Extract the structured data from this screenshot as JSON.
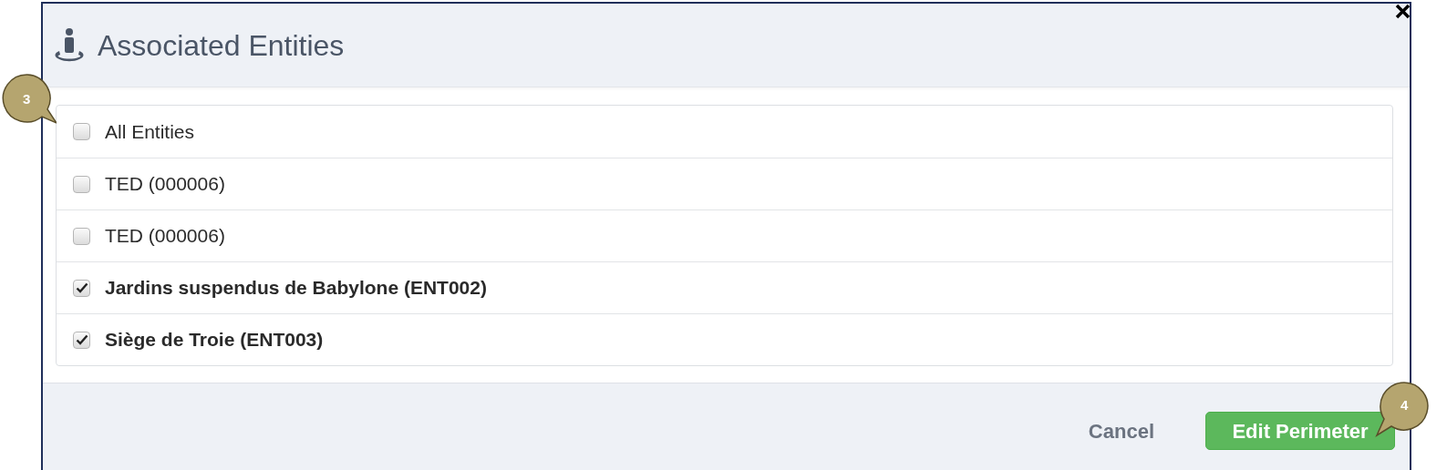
{
  "dialog": {
    "title": "Associated Entities"
  },
  "entities": [
    {
      "label": "All Entities",
      "checked": false
    },
    {
      "label": "TED (000006)",
      "checked": false
    },
    {
      "label": "TED (000006)",
      "checked": false
    },
    {
      "label": "Jardins suspendus de Babylone (ENT002)",
      "checked": true
    },
    {
      "label": "Siège de Troie (ENT003)",
      "checked": true
    }
  ],
  "buttons": {
    "cancel": "Cancel",
    "confirm": "Edit Perimeter"
  },
  "callouts": [
    {
      "label": "3",
      "kind": "left"
    },
    {
      "label": "4",
      "kind": "right"
    }
  ]
}
